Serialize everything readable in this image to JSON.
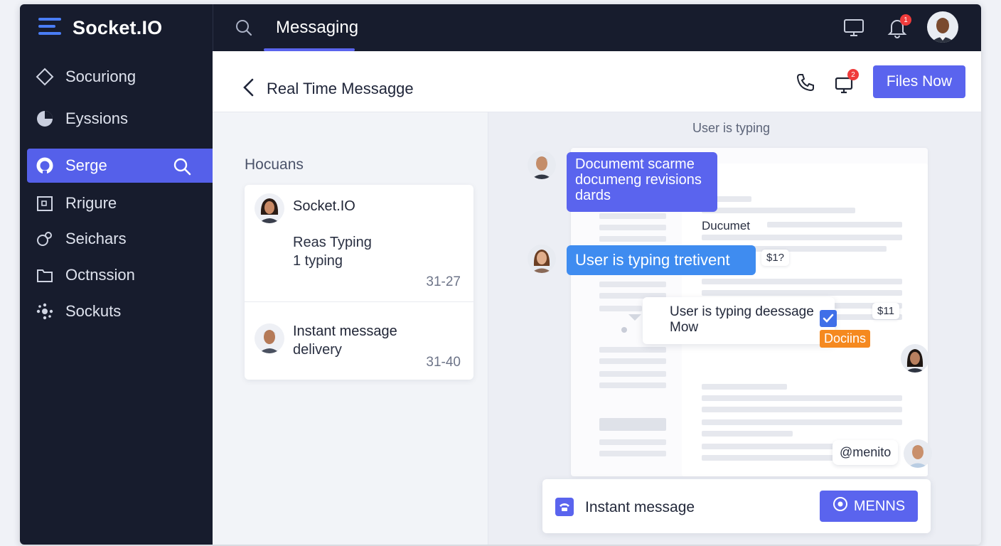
{
  "brand": {
    "name": "Socket.IO"
  },
  "sidebar": {
    "items": [
      {
        "label": "Socuriong",
        "icon": "diamond-outline-icon"
      },
      {
        "label": "Eyssions",
        "icon": "pie-chart-icon"
      },
      {
        "label": "Serge",
        "icon": "ring-icon",
        "active": true
      },
      {
        "label": "Rrigure",
        "icon": "frame-box-icon"
      },
      {
        "label": "Seichars",
        "icon": "link-circles-icon"
      },
      {
        "label": "Octnssion",
        "icon": "folder-icon"
      },
      {
        "label": "Sockuts",
        "icon": "dots-cluster-icon"
      }
    ]
  },
  "topbar": {
    "tab": "Messaging",
    "notifications_count": "1"
  },
  "header": {
    "title": "Real Time Messagge",
    "files_button": "Files Now",
    "screen_badge": "2"
  },
  "list": {
    "heading": "Hocuans",
    "items": [
      {
        "name": "Socket.IO",
        "line1": "Reas Typing",
        "line2": "1 typing",
        "time": "31-27"
      },
      {
        "name": "Instant message",
        "line2": "delivery",
        "time": "31-40"
      }
    ]
  },
  "chat": {
    "typing_status": "User is typing",
    "bubble1": {
      "line1": "Documemt scarme",
      "line2": "documeng revisions",
      "line3": "dards"
    },
    "bubble2": "User is typing tretivent",
    "tag1": "$1?",
    "doc_label": "Ducumet",
    "note": {
      "line1": "User is typing deessage",
      "line2": "Mow"
    },
    "tag2": "$11",
    "orange_tag": "Dociins",
    "mention": "@menito",
    "composer_text": "Instant message",
    "send_button": "MENNS"
  },
  "colors": {
    "accent": "#5a64ee",
    "sidebar": "#171c2d",
    "bubble_blue": "#3f8cf0",
    "orange": "#f5891f"
  }
}
